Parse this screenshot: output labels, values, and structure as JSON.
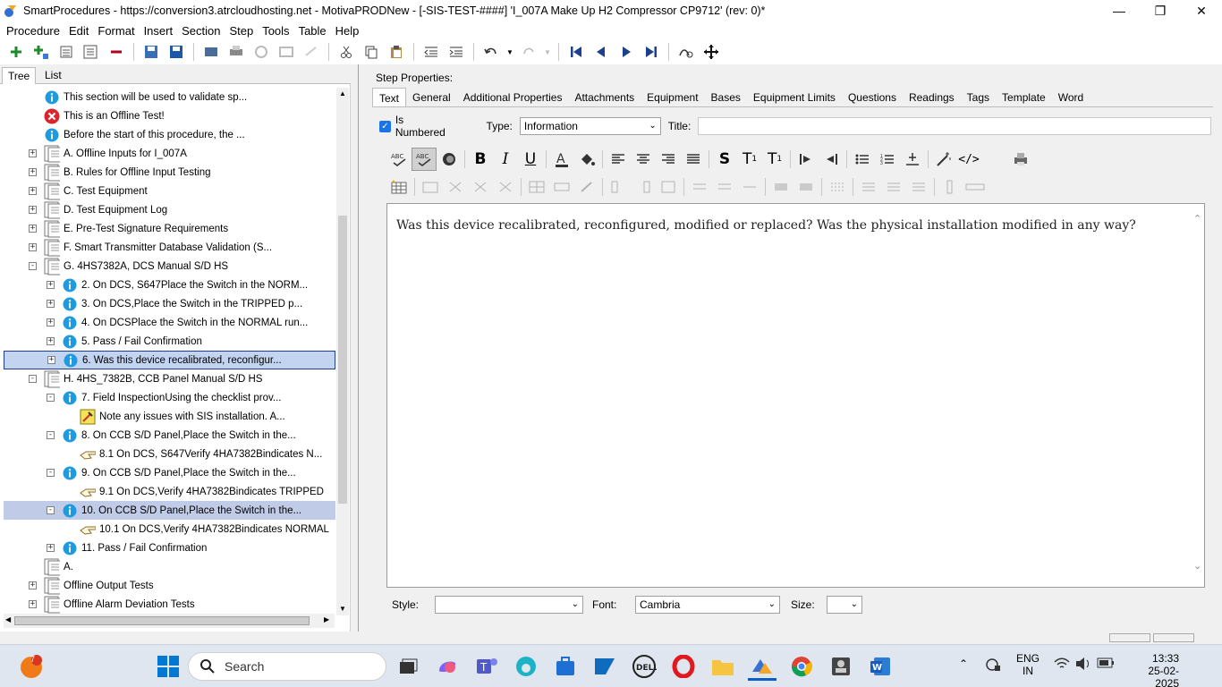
{
  "window": {
    "title": "SmartProcedures - https://conversion3.atrcloudhosting.net - MotivaPRODNew - [-SIS-TEST-####] 'I_007A Make Up H2 Compressor CP9712' (rev: 0)*",
    "minimize": "—",
    "maximize": "❐",
    "close": "✕"
  },
  "menu": [
    "Procedure",
    "Edit",
    "Format",
    "Insert",
    "Section",
    "Step",
    "Tools",
    "Table",
    "Help"
  ],
  "left_tabs": [
    "Tree",
    "List"
  ],
  "tree": [
    {
      "indent": 1,
      "exp": "",
      "icon": "info",
      "text": "This section will be used to validate sp..."
    },
    {
      "indent": 1,
      "exp": "",
      "icon": "error",
      "text": "This is an Offline Test!"
    },
    {
      "indent": 1,
      "exp": "",
      "icon": "info",
      "text": "Before the start of this procedure, the ..."
    },
    {
      "indent": 1,
      "exp": "+",
      "icon": "section",
      "text": "A. Offline Inputs for I_007A"
    },
    {
      "indent": 1,
      "exp": "+",
      "icon": "section",
      "text": "B. Rules for Offline Input Testing"
    },
    {
      "indent": 1,
      "exp": "+",
      "icon": "section",
      "text": "C. Test Equipment"
    },
    {
      "indent": 1,
      "exp": "+",
      "icon": "section",
      "text": "D. Test Equipment Log"
    },
    {
      "indent": 1,
      "exp": "+",
      "icon": "section",
      "text": "E. Pre-Test Signature Requirements"
    },
    {
      "indent": 1,
      "exp": "+",
      "icon": "section",
      "text": "F. Smart Transmitter Database Validation (S..."
    },
    {
      "indent": 1,
      "exp": "-",
      "icon": "section",
      "text": "G. 4HS7382A, DCS Manual S/D HS"
    },
    {
      "indent": 2,
      "exp": "+",
      "icon": "info",
      "text": "2. On DCS, S647Place the Switch in the NORM..."
    },
    {
      "indent": 2,
      "exp": "+",
      "icon": "info",
      "text": "3. On DCS,Place the Switch in the TRIPPED p..."
    },
    {
      "indent": 2,
      "exp": "+",
      "icon": "info",
      "text": "4. On DCSPlace the Switch in the NORMAL run..."
    },
    {
      "indent": 2,
      "exp": "+",
      "icon": "info",
      "text": "5. Pass / Fail Confirmation"
    },
    {
      "indent": 2,
      "exp": "+",
      "icon": "info",
      "text": "6. Was this device recalibrated, reconfigur...",
      "state": "focus"
    },
    {
      "indent": 1,
      "exp": "-",
      "icon": "section",
      "text": "H. 4HS_7382B, CCB Panel Manual S/D HS"
    },
    {
      "indent": 2,
      "exp": "-",
      "icon": "info",
      "text": "7. Field InspectionUsing the checklist prov..."
    },
    {
      "indent": 3,
      "exp": "",
      "icon": "note",
      "text": "Note any issues with SIS installation. A..."
    },
    {
      "indent": 2,
      "exp": "-",
      "icon": "info",
      "text": "8. On CCB S/D Panel,Place the Switch in the..."
    },
    {
      "indent": 3,
      "exp": "",
      "icon": "hand",
      "text": "8.1  On DCS, S647Verify  4HA7382Bindicates  N..."
    },
    {
      "indent": 2,
      "exp": "-",
      "icon": "info",
      "text": "9. On CCB S/D Panel,Place the Switch in the..."
    },
    {
      "indent": 3,
      "exp": "",
      "icon": "hand",
      "text": "9.1 On DCS,Verify 4HA7382Bindicates TRIPPED"
    },
    {
      "indent": 2,
      "exp": "-",
      "icon": "info",
      "text": "10. On CCB S/D Panel,Place the Switch in the...",
      "state": "sel"
    },
    {
      "indent": 3,
      "exp": "",
      "icon": "hand",
      "text": "10.1 On DCS,Verify 4HA7382Bindicates NORMAL"
    },
    {
      "indent": 2,
      "exp": "+",
      "icon": "info",
      "text": "11. Pass / Fail Confirmation"
    },
    {
      "indent": 0,
      "exp": "",
      "icon": "section",
      "text": "A."
    },
    {
      "indent": 0,
      "exp": "+",
      "icon": "section",
      "text": "Offline Output Tests"
    },
    {
      "indent": 0,
      "exp": "+",
      "icon": "section",
      "text": "Offline Alarm Deviation Tests"
    }
  ],
  "step_properties_label": "Step Properties:",
  "right_tabs": [
    "Text",
    "General",
    "Additional Properties",
    "Attachments",
    "Equipment",
    "Bases",
    "Equipment Limits",
    "Questions",
    "Readings",
    "Tags",
    "Template",
    "Word"
  ],
  "props": {
    "is_numbered_label": "Is Numbered",
    "type_label": "Type:",
    "type_value": "Information",
    "title_label": "Title:",
    "title_value": ""
  },
  "editor_text": "Was this device recalibrated, reconfigured, modified or replaced? Was the physical installation modified in any way?",
  "format_row": {
    "style_label": "Style:",
    "style_value": "",
    "font_label": "Font:",
    "font_value": "Cambria",
    "size_label": "Size:",
    "size_value": ""
  },
  "taskbar": {
    "search_placeholder": "Search",
    "weather_badge": "7",
    "lang1": "ENG",
    "lang2": "IN",
    "time": "13:33",
    "date": "25-02-2025"
  },
  "colors": {
    "accent": "#1a73e8",
    "info_icon": "#1e9be0",
    "error_icon": "#d8262c",
    "selection_focus": "#c3d4f1",
    "selection": "#c0cbe8"
  }
}
